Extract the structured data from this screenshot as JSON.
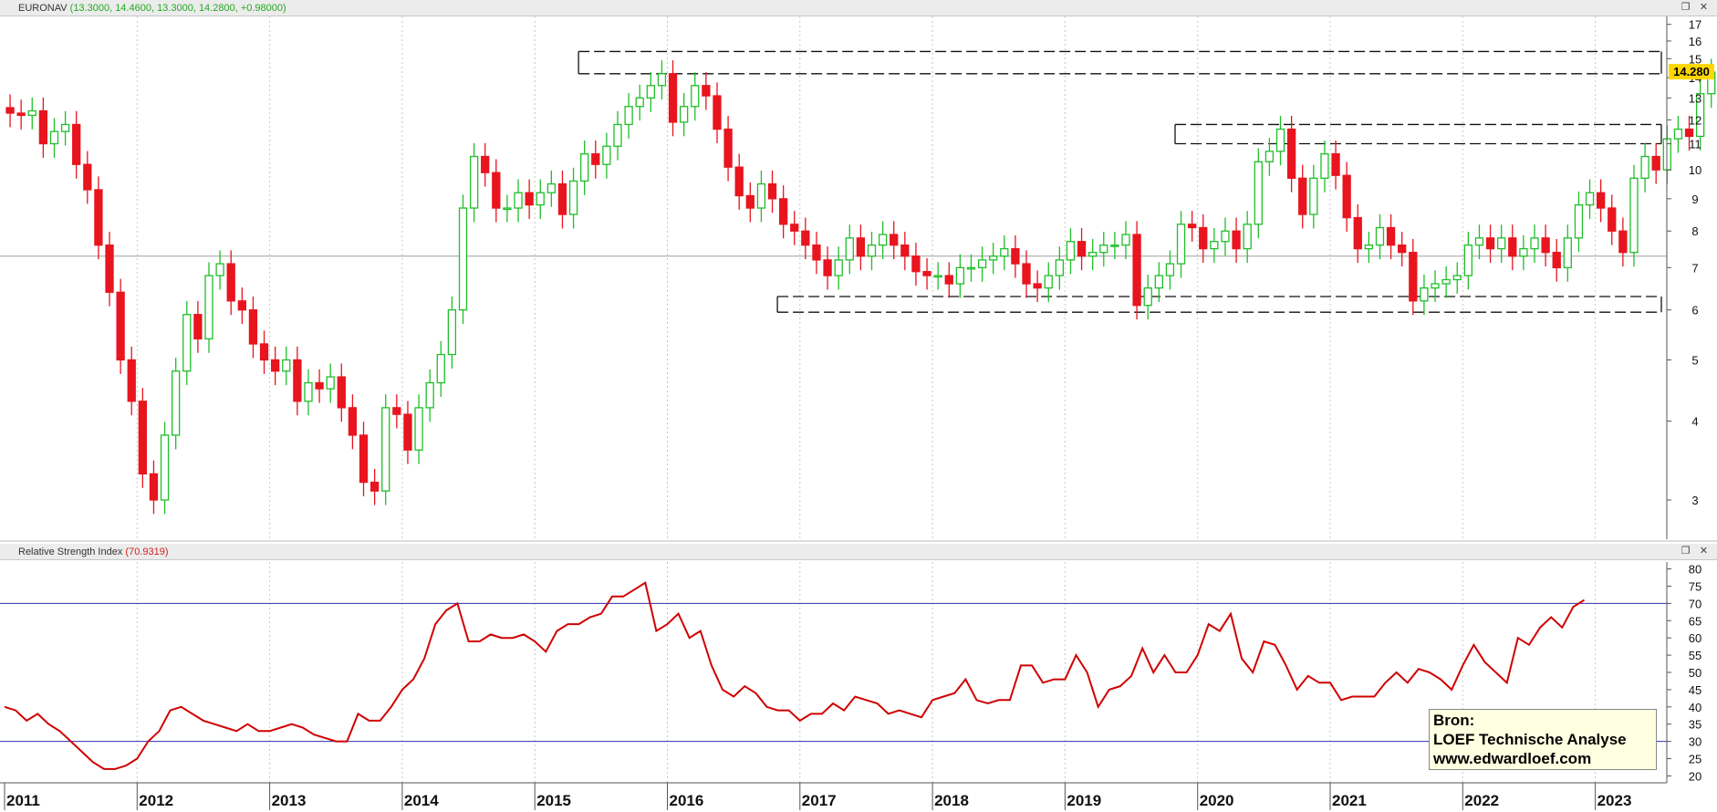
{
  "header": {
    "price_title": "EURONAV",
    "price_values": "(13.3000, 14.4600, 13.3000, 14.2800, +0.98000)",
    "rsi_title": "Relative Strength Index",
    "rsi_value": "(70.9319)",
    "restore_icon": "restore-icon",
    "close_icon": "close-icon"
  },
  "source_box": {
    "line1": "Bron:",
    "line2": "LOEF Technische Analyse",
    "line3": "www.edwardloef.com"
  },
  "colors": {
    "up": "#1fbf2a",
    "down": "#e8141e",
    "rsi_line": "#d00000",
    "rsi_levels": "#3030b0",
    "price_label_bg": "#ffd700",
    "grid": "#c8c8c8"
  },
  "chart_data": [
    {
      "type": "candlestick",
      "title": "EURONAV",
      "interval": "monthly",
      "y_scale": "log",
      "ylim": [
        2.6,
        17.5
      ],
      "y_ticks": [
        3,
        4,
        5,
        6,
        7,
        8,
        9,
        10,
        11,
        12,
        13,
        14,
        15,
        16,
        17
      ],
      "x_ticks": [
        "2011",
        "2012",
        "2013",
        "2014",
        "2015",
        "2016",
        "2017",
        "2018",
        "2019",
        "2020",
        "2021",
        "2022",
        "2023"
      ],
      "last_price_label": "14.280",
      "horizontal_line": 7.3,
      "zones": [
        {
          "from": 14.2,
          "to": 15.4,
          "start": 2015.33
        },
        {
          "from": 11.0,
          "to": 11.8,
          "start": 2019.83
        },
        {
          "from": 5.95,
          "to": 6.3,
          "start": 2016.83
        }
      ],
      "closes": [
        12.3,
        12.2,
        12.4,
        11.0,
        11.5,
        11.8,
        10.2,
        9.3,
        7.6,
        6.4,
        5.0,
        4.3,
        3.3,
        3.0,
        3.8,
        4.8,
        5.9,
        5.4,
        6.8,
        7.1,
        6.2,
        6.0,
        5.3,
        5.0,
        4.8,
        5.0,
        4.3,
        4.6,
        4.5,
        4.7,
        4.2,
        3.8,
        3.2,
        3.1,
        4.2,
        4.1,
        3.6,
        4.2,
        4.6,
        5.1,
        6.0,
        8.7,
        10.5,
        9.9,
        8.7,
        8.7,
        9.2,
        8.8,
        9.2,
        9.5,
        8.5,
        9.6,
        10.6,
        10.2,
        10.9,
        11.8,
        12.6,
        13.0,
        13.6,
        14.2,
        11.9,
        12.6,
        13.6,
        13.1,
        11.6,
        10.1,
        9.1,
        8.7,
        9.5,
        9.0,
        8.2,
        8.0,
        7.6,
        7.2,
        6.8,
        7.2,
        7.8,
        7.3,
        7.6,
        7.9,
        7.6,
        7.3,
        6.9,
        6.8,
        6.8,
        6.6,
        7.0,
        7.0,
        7.2,
        7.3,
        7.5,
        7.1,
        6.6,
        6.5,
        6.8,
        7.2,
        7.7,
        7.3,
        7.4,
        7.6,
        7.6,
        7.9,
        6.1,
        6.5,
        6.8,
        7.1,
        8.2,
        8.1,
        7.5,
        7.7,
        8.0,
        7.5,
        8.2,
        10.3,
        10.7,
        11.6,
        9.7,
        8.5,
        9.7,
        10.6,
        9.8,
        8.4,
        7.5,
        7.6,
        8.1,
        7.6,
        7.4,
        6.2,
        6.5,
        6.6,
        6.7,
        6.8,
        7.6,
        7.8,
        7.5,
        7.8,
        7.3,
        7.5,
        7.8,
        7.4,
        7.0,
        7.8,
        8.8,
        9.2,
        8.7,
        8.0,
        7.4,
        9.7,
        10.5,
        10.0,
        11.2,
        11.6,
        11.3,
        13.2,
        14.28
      ],
      "notes": "Monthly OHLC; green hollow = up month, red filled = down month; values approximated"
    },
    {
      "type": "line",
      "title": "Relative Strength Index",
      "ylim": [
        18,
        82
      ],
      "y_ticks": [
        20,
        25,
        30,
        35,
        40,
        45,
        50,
        55,
        60,
        65,
        70,
        75,
        80
      ],
      "levels": [
        70,
        30
      ],
      "last_value": 70.9319,
      "values": [
        40,
        39,
        36,
        38,
        35,
        33,
        30,
        27,
        24,
        22,
        22,
        23,
        25,
        30,
        33,
        39,
        40,
        38,
        36,
        35,
        34,
        33,
        35,
        33,
        33,
        34,
        35,
        34,
        32,
        31,
        30,
        30,
        38,
        36,
        36,
        40,
        45,
        48,
        54,
        64,
        68,
        70,
        59,
        59,
        61,
        60,
        60,
        61,
        59,
        56,
        62,
        64,
        64,
        66,
        67,
        72,
        72,
        74,
        76,
        62,
        64,
        67,
        60,
        62,
        52,
        45,
        43,
        46,
        44,
        40,
        39,
        39,
        36,
        38,
        38,
        41,
        39,
        43,
        42,
        41,
        38,
        39,
        38,
        37,
        42,
        43,
        44,
        48,
        42,
        41,
        42,
        42,
        52,
        52,
        47,
        48,
        48,
        55,
        50,
        40,
        45,
        46,
        49,
        57,
        50,
        55,
        50,
        50,
        55,
        64,
        62,
        67,
        54,
        50,
        59,
        58,
        52,
        45,
        49,
        47,
        47,
        42,
        43,
        43,
        43,
        47,
        50,
        47,
        51,
        50,
        48,
        45,
        52,
        58,
        53,
        50,
        47,
        60,
        58,
        63,
        66,
        63,
        69,
        71
      ]
    }
  ]
}
